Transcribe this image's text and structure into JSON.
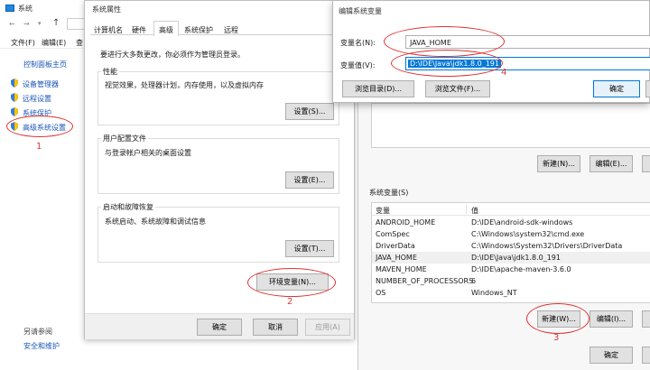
{
  "system_window": {
    "title": "系统",
    "address_arrow": "↑",
    "menu": [
      "文件(F)",
      "编辑(E)",
      "查"
    ],
    "control_panel_home": "控制面板主页",
    "side_links": [
      "设备管理器",
      "远程设置",
      "系统保护",
      "高级系统设置"
    ],
    "see_also": "另请参阅",
    "security_link": "安全和维护"
  },
  "sysprop": {
    "title": "系统属性",
    "tabs": [
      "计算机名",
      "硬件",
      "高级",
      "系统保护",
      "远程"
    ],
    "admin_note": "要进行大多数更改，你必须作为管理员登录。",
    "perf": {
      "title": "性能",
      "desc": "视觉效果，处理器计划，内存使用，以及虚拟内存",
      "button": "设置(S)..."
    },
    "profile": {
      "title": "用户配置文件",
      "desc": "与登录帐户相关的桌面设置",
      "button": "设置(E)..."
    },
    "startup": {
      "title": "启动和故障恢复",
      "desc": "系统启动、系统故障和调试信息",
      "button": "设置(T)..."
    },
    "env_button": "环境变量(N)...",
    "ok": "确定",
    "cancel": "取消",
    "apply": "应用(A)"
  },
  "env_window": {
    "user_buttons": [
      "新建(N)...",
      "编辑(E)..."
    ],
    "system_vars_title": "系统变量(S)",
    "col_var": "变量",
    "col_val": "值",
    "rows": [
      {
        "name": "ANDROID_HOME",
        "value": "D:\\IDE\\android-sdk-windows"
      },
      {
        "name": "ComSpec",
        "value": "C:\\Windows\\system32\\cmd.exe"
      },
      {
        "name": "DriverData",
        "value": "C:\\Windows\\System32\\Drivers\\DriverData"
      },
      {
        "name": "JAVA_HOME",
        "value": "D:\\IDE\\Java\\jdk1.8.0_191"
      },
      {
        "name": "MAVEN_HOME",
        "value": "D:\\IDE\\apache-maven-3.6.0"
      },
      {
        "name": "NUMBER_OF_PROCESSORS",
        "value": "6"
      },
      {
        "name": "OS",
        "value": "Windows_NT"
      }
    ],
    "new_button": "新建(W)...",
    "edit_button": "编辑(I)...",
    "ok": "确定"
  },
  "edit_dialog": {
    "title": "编辑系统变量",
    "name_label": "变量名(N):",
    "name_value": "JAVA_HOME",
    "value_label": "变量值(V):",
    "value_value": "D:\\IDE\\Java\\jdk1.8.0_191",
    "browse_dir": "浏览目录(D)...",
    "browse_file": "浏览文件(F)...",
    "ok": "确定"
  },
  "annotations": [
    "1",
    "2",
    "3",
    "4"
  ],
  "colors": {
    "accent": "#0078d7",
    "highlight": "#e03030",
    "selection": "#0078d7"
  }
}
